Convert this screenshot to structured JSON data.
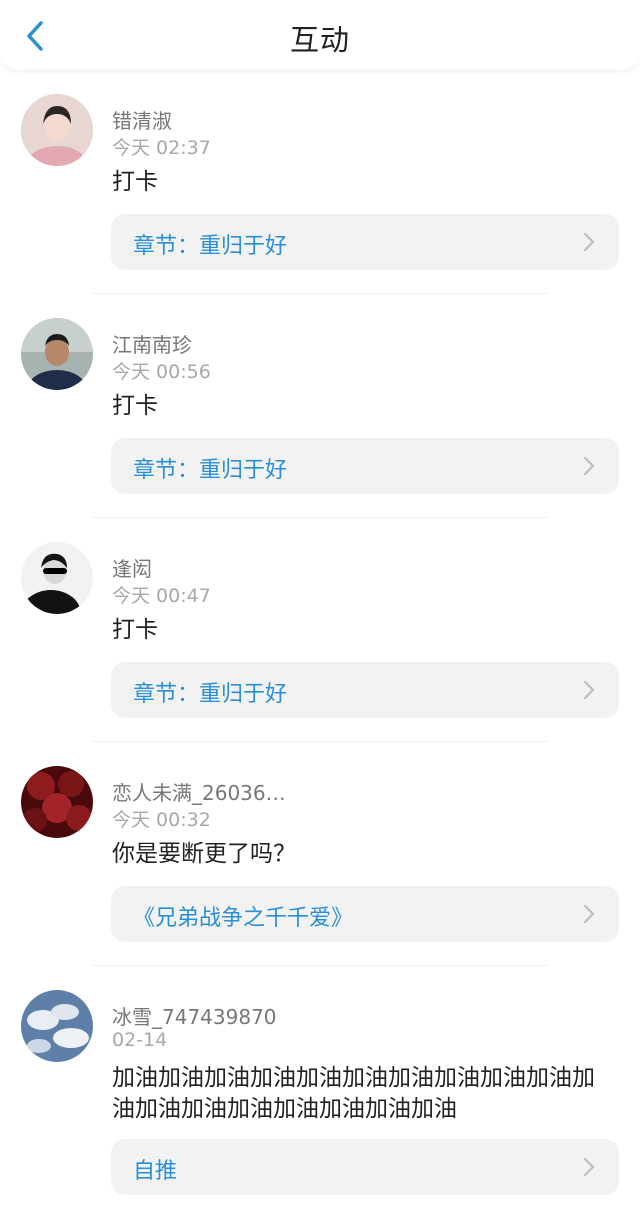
{
  "header": {
    "title": "互动"
  },
  "items": [
    {
      "name": "错清淑",
      "time": "今天 02:37",
      "content": "打卡",
      "link": "章节：重归于好"
    },
    {
      "name": "江南南珍",
      "time": "今天 00:56",
      "content": "打卡",
      "link": "章节：重归于好"
    },
    {
      "name": "逢闳",
      "time": "今天 00:47",
      "content": "打卡",
      "link": "章节：重归于好"
    },
    {
      "name": "恋人未满_26036…",
      "time": "今天 00:32",
      "content": "你是要断更了吗？",
      "link": "《兄弟战争之千千爱》"
    },
    {
      "name": "冰雪_747439870",
      "time": "02-14",
      "content": "加油加油加油加油加油加油加油加油加油加油加油加油加油加油加油加油加油加油",
      "link": "自推"
    }
  ],
  "colors": {
    "accent": "#2a8fd9",
    "link_bg": "#f2f2f2",
    "meta_text": "#a8a8a8"
  },
  "icons": {
    "back": "chevron-left-icon",
    "row": "chevron-right-icon"
  }
}
